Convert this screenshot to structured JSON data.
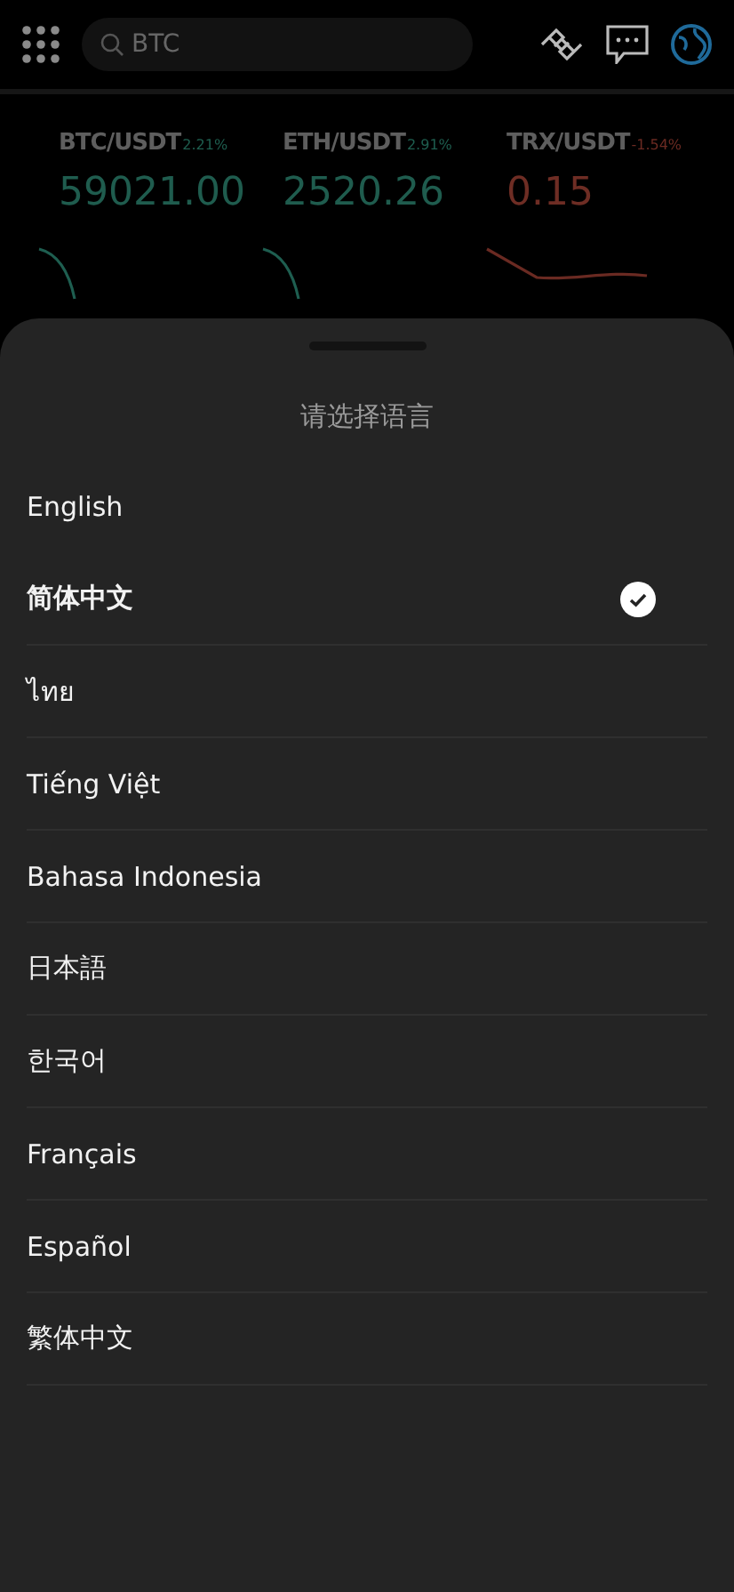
{
  "header": {
    "search": {
      "value": "BTC"
    }
  },
  "tickers": [
    {
      "pair": "BTC/USDT",
      "change": "2.21%",
      "price": "59021.00",
      "kind": "up"
    },
    {
      "pair": "ETH/USDT",
      "change": "2.91%",
      "price": "2520.26",
      "kind": "up"
    },
    {
      "pair": "TRX/USDT",
      "change": "-1.54%",
      "price": "0.15",
      "kind": "down"
    }
  ],
  "language_sheet": {
    "title": "请选择语言",
    "languages": [
      {
        "label": "English",
        "selected": false
      },
      {
        "label": "简体中文",
        "selected": true
      },
      {
        "label": "ไทย",
        "selected": false
      },
      {
        "label": "Tiếng Việt",
        "selected": false
      },
      {
        "label": "Bahasa Indonesia",
        "selected": false
      },
      {
        "label": "日本語",
        "selected": false
      },
      {
        "label": "한국어",
        "selected": false
      },
      {
        "label": "Français",
        "selected": false
      },
      {
        "label": "Español",
        "selected": false
      },
      {
        "label": "繁体中文",
        "selected": false
      }
    ]
  }
}
